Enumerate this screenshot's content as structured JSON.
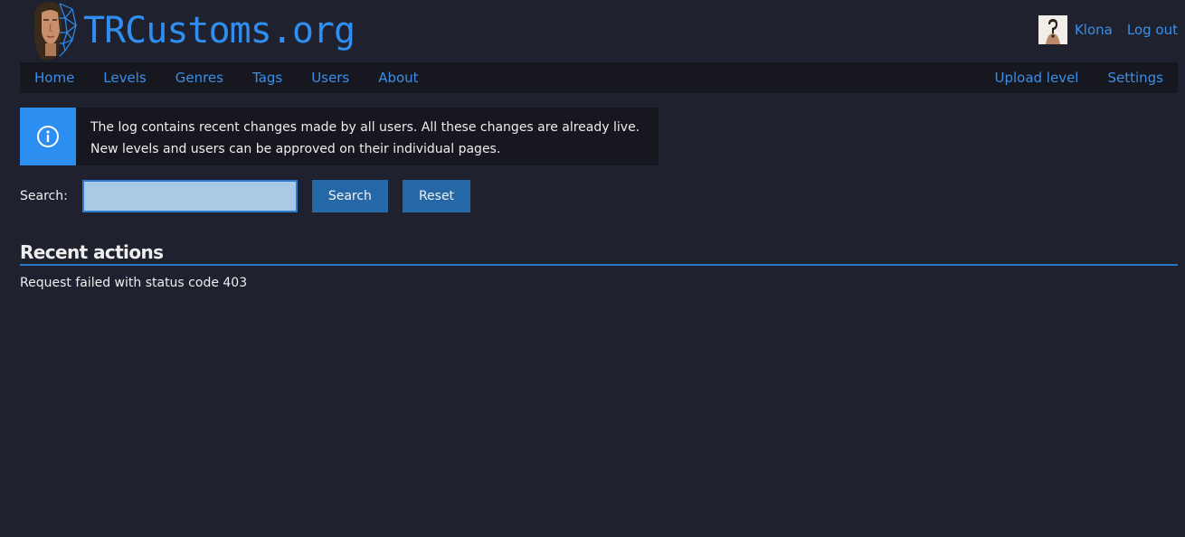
{
  "header": {
    "logo_text": "TRCustoms.org",
    "user": {
      "username": "Klona",
      "logout_label": "Log out"
    }
  },
  "nav": {
    "left": [
      {
        "label": "Home"
      },
      {
        "label": "Levels"
      },
      {
        "label": "Genres"
      },
      {
        "label": "Tags"
      },
      {
        "label": "Users"
      },
      {
        "label": "About"
      }
    ],
    "right": [
      {
        "label": "Upload level"
      },
      {
        "label": "Settings"
      }
    ]
  },
  "info": {
    "line1": "The log contains recent changes made by all users. All these changes are already live.",
    "line2": "New levels and users can be approved on their individual pages."
  },
  "search": {
    "label": "Search:",
    "value": "",
    "search_label": "Search",
    "reset_label": "Reset"
  },
  "recent": {
    "title": "Recent actions",
    "error": "Request failed with status code 403"
  },
  "colors": {
    "background": "#1f212e",
    "bar": "#16171f",
    "accent": "#2f8ef0",
    "button": "#2468a8"
  }
}
